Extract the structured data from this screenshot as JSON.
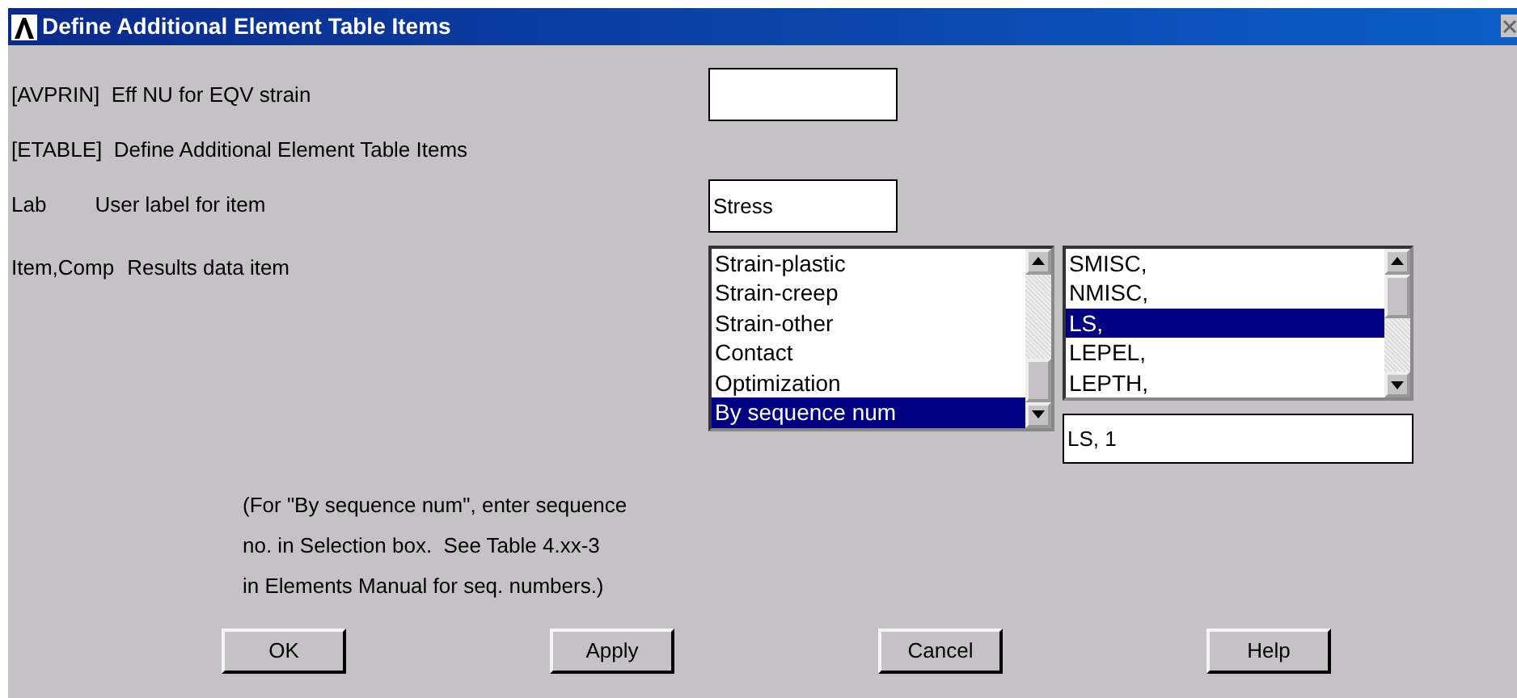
{
  "window": {
    "title": "Define Additional Element Table Items"
  },
  "avprin": {
    "label": "[AVPRIN]  Eff NU for EQV strain"
  },
  "etable": {
    "label": "[ETABLE]  Define Additional Element Table Items"
  },
  "lab": {
    "key": "Lab",
    "label": "User label for item",
    "value": "Stress"
  },
  "item": {
    "key": "Item,Comp",
    "label": "Results data item",
    "list_1": [
      {
        "text": "Strain-plastic",
        "selected": false
      },
      {
        "text": "Strain-creep",
        "selected": false
      },
      {
        "text": "Strain-other",
        "selected": false
      },
      {
        "text": "Contact",
        "selected": false
      },
      {
        "text": "Optimization",
        "selected": false
      },
      {
        "text": "By sequence num",
        "selected": true
      }
    ],
    "list_2": [
      {
        "text": "SMISC,",
        "selected": false
      },
      {
        "text": "NMISC,",
        "selected": false
      },
      {
        "text": "LS,",
        "selected": true
      },
      {
        "text": "LEPEL,",
        "selected": false
      },
      {
        "text": "LEPTH,",
        "selected": false
      }
    ],
    "selection": "LS, 1"
  },
  "note": [
    "(For \"By sequence num\", enter sequence",
    "no. in Selection box.  See Table 4.xx-3",
    "in Elements Manual for seq. numbers.)"
  ],
  "buttons": [
    "OK",
    "Apply",
    "Cancel",
    "Help"
  ]
}
